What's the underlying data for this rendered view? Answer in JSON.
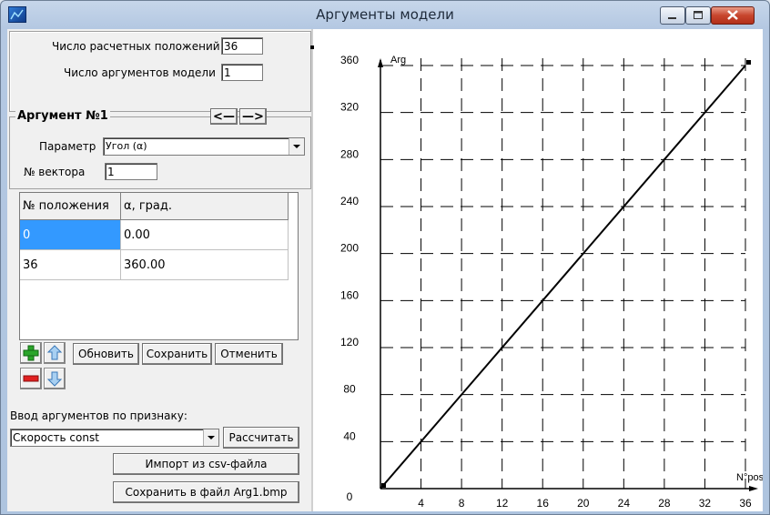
{
  "window": {
    "title": "Аргументы модели"
  },
  "top_panel": {
    "positions_label": "Число расчетных положений",
    "positions_value": "36",
    "args_label": "Число аргументов модели",
    "args_value": "1"
  },
  "argument_group": {
    "title": "Аргумент №1",
    "prev_label": "<—",
    "next_label": "—>",
    "param_label": "Параметр",
    "param_value": "Угол  (α)",
    "vector_label": "№ вектора",
    "vector_value": "1"
  },
  "table": {
    "headers": [
      "№ положения",
      "α, град."
    ],
    "rows": [
      [
        "0",
        "0.00"
      ],
      [
        "36",
        "360.00"
      ]
    ]
  },
  "buttons": {
    "refresh": "Обновить",
    "save": "Сохранить",
    "cancel": "Отменить",
    "compute": "Рассчитать",
    "import_csv": "Импорт из csv-файла",
    "save_bmp": "Сохранить в файл Arg1.bmp"
  },
  "input_by_feature": {
    "label": "Ввод аргументов по признаку:",
    "value": "Скорость const"
  },
  "colors": {
    "accent": "#3399ff",
    "grid": "#000000",
    "line": "#000000"
  },
  "chart_data": {
    "type": "line",
    "xlabel": "N°pos",
    "ylabel": "Arg",
    "xlim": [
      0,
      36
    ],
    "ylim": [
      0,
      360
    ],
    "x_ticks": [
      4,
      8,
      12,
      16,
      20,
      24,
      28,
      32,
      36
    ],
    "y_ticks": [
      0,
      40,
      80,
      120,
      160,
      200,
      240,
      280,
      320,
      360
    ],
    "grid": true,
    "series": [
      {
        "x": [
          0,
          36
        ],
        "values": [
          0,
          360
        ]
      }
    ]
  }
}
